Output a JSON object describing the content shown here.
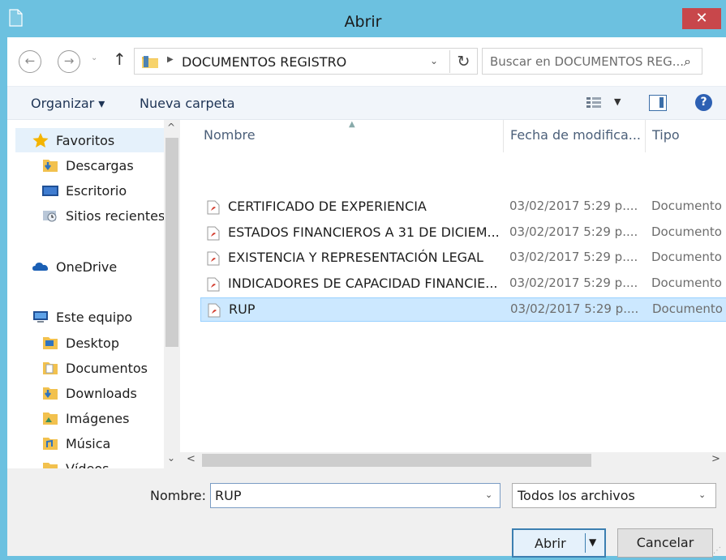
{
  "window": {
    "title": "Abrir",
    "close_label": "✕"
  },
  "address": {
    "path": "DOCUMENTOS REGISTRO",
    "search_placeholder": "Buscar en DOCUMENTOS REG...",
    "back_label": "←",
    "forward_label": "→",
    "up_label": "↑",
    "refresh_label": "↻",
    "search_icon": "⌕"
  },
  "toolbar": {
    "organize_label": "Organizar ▾",
    "new_folder_label": "Nueva carpeta",
    "help_label": "?"
  },
  "nav": {
    "favorites": {
      "label": "Favoritos",
      "icon": "star-icon"
    },
    "favorites_items": [
      {
        "label": "Descargas",
        "icon": "downloads-folder-icon"
      },
      {
        "label": "Escritorio",
        "icon": "desktop-icon"
      },
      {
        "label": "Sitios recientes",
        "icon": "recent-places-icon"
      }
    ],
    "onedrive": {
      "label": "OneDrive",
      "icon": "cloud-icon"
    },
    "this_pc": {
      "label": "Este equipo",
      "icon": "computer-icon"
    },
    "pc_items": [
      {
        "label": "Desktop"
      },
      {
        "label": "Documentos"
      },
      {
        "label": "Downloads"
      },
      {
        "label": "Imágenes"
      },
      {
        "label": "Música"
      },
      {
        "label": "Vídeos"
      }
    ]
  },
  "columns": {
    "name": "Nombre",
    "date": "Fecha de modifica...",
    "type": "Tipo"
  },
  "files": [
    {
      "name": "CERTIFICADO DE EXPERIENCIA",
      "date": "03/02/2017 5:29 p....",
      "type": "Documento",
      "selected": false
    },
    {
      "name": "ESTADOS FINANCIEROS A 31 DE DICIEM...",
      "date": "03/02/2017 5:29 p....",
      "type": "Documento",
      "selected": false
    },
    {
      "name": "EXISTENCIA Y REPRESENTACIÓN LEGAL",
      "date": "03/02/2017 5:29 p....",
      "type": "Documento",
      "selected": false
    },
    {
      "name": "INDICADORES DE CAPACIDAD FINANCIE...",
      "date": "03/02/2017 5:29 p....",
      "type": "Documento",
      "selected": false
    },
    {
      "name": "RUP",
      "date": "03/02/2017 5:29 p....",
      "type": "Documento",
      "selected": true
    }
  ],
  "bottom": {
    "filename_label": "Nombre:",
    "filename_value": "RUP",
    "filter_value": "Todos los archivos",
    "open_label": "Abrir",
    "cancel_label": "Cancelar"
  },
  "colors": {
    "titlebar": "#6cc1e0",
    "close": "#c8474b",
    "selection": "#cce8ff",
    "accent": "#3c7fb1"
  }
}
